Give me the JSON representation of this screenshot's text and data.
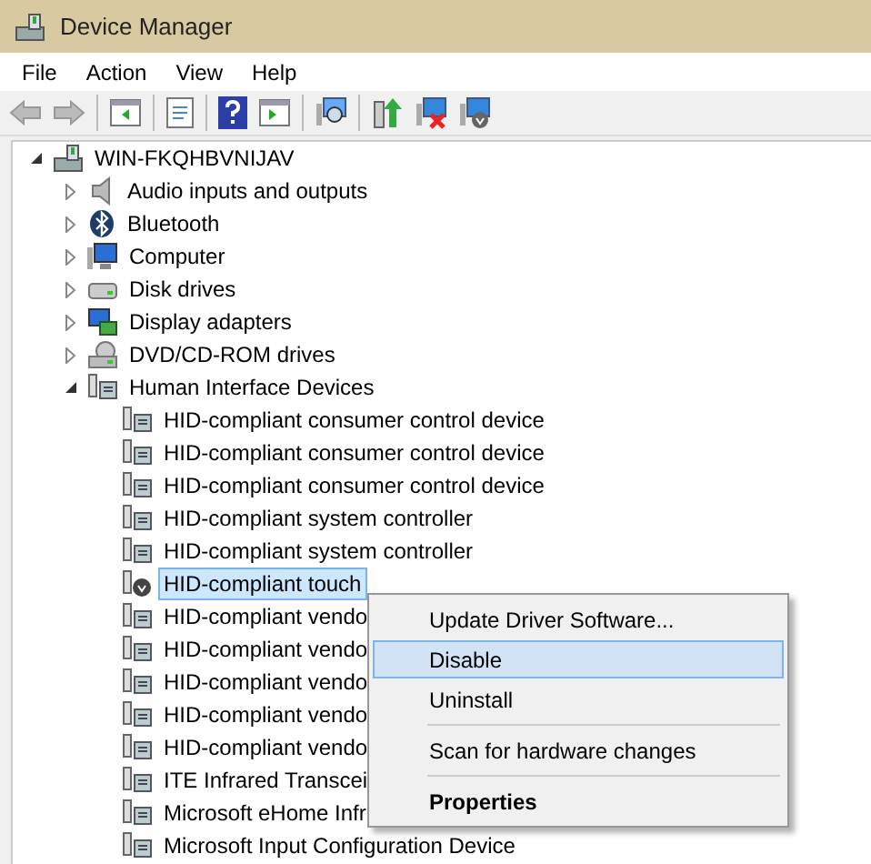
{
  "window": {
    "title": "Device Manager"
  },
  "menu": [
    "File",
    "Action",
    "View",
    "Help"
  ],
  "toolbar": [
    {
      "kind": "back",
      "disabled": true
    },
    {
      "kind": "forward",
      "disabled": true
    },
    {
      "kind": "sep"
    },
    {
      "kind": "panel"
    },
    {
      "kind": "sep"
    },
    {
      "kind": "properties"
    },
    {
      "kind": "sep"
    },
    {
      "kind": "help"
    },
    {
      "kind": "panel2"
    },
    {
      "kind": "sep"
    },
    {
      "kind": "scan"
    },
    {
      "kind": "sep"
    },
    {
      "kind": "update"
    },
    {
      "kind": "disable"
    },
    {
      "kind": "uninstall"
    }
  ],
  "tree": [
    {
      "label": "WIN-FKQHBVNIJAV",
      "kind": "computer",
      "expanded": true,
      "selected": false,
      "children": [
        {
          "label": "Audio inputs and outputs",
          "kind": "speaker",
          "expanded": false,
          "selected": false
        },
        {
          "label": "Bluetooth",
          "kind": "bluetooth",
          "expanded": false,
          "selected": false
        },
        {
          "label": "Computer",
          "kind": "monitor",
          "expanded": false,
          "selected": false
        },
        {
          "label": "Disk drives",
          "kind": "disk",
          "expanded": false,
          "selected": false
        },
        {
          "label": "Display adapters",
          "kind": "display",
          "expanded": false,
          "selected": false
        },
        {
          "label": "DVD/CD-ROM drives",
          "kind": "dvd",
          "expanded": false,
          "selected": false
        },
        {
          "label": "Human Interface Devices",
          "kind": "hid",
          "expanded": true,
          "selected": false,
          "children": [
            {
              "label": "HID-compliant consumer control device",
              "selected": false
            },
            {
              "label": "HID-compliant consumer control device",
              "selected": false
            },
            {
              "label": "HID-compliant consumer control device",
              "selected": false
            },
            {
              "label": "HID-compliant system controller",
              "selected": false
            },
            {
              "label": "HID-compliant system controller",
              "selected": false
            },
            {
              "label": "HID-compliant touch",
              "kind": "hid-down",
              "selected": true
            },
            {
              "label": "HID-compliant vendo",
              "selected": false
            },
            {
              "label": "HID-compliant vendo",
              "selected": false
            },
            {
              "label": "HID-compliant vendo",
              "selected": false
            },
            {
              "label": "HID-compliant vendo",
              "selected": false
            },
            {
              "label": "HID-compliant vendo",
              "selected": false
            },
            {
              "label": "ITE Infrared Transcei",
              "selected": false
            },
            {
              "label": "Microsoft eHome Infr",
              "selected": false
            },
            {
              "label": "Microsoft Input Configuration Device",
              "selected": false
            }
          ]
        }
      ]
    }
  ],
  "context_menu": [
    {
      "kind": "item",
      "label": "Update Driver Software...",
      "selected": false,
      "bold": false
    },
    {
      "kind": "item",
      "label": "Disable",
      "selected": true,
      "bold": false
    },
    {
      "kind": "item",
      "label": "Uninstall",
      "selected": false,
      "bold": false
    },
    {
      "kind": "separator"
    },
    {
      "kind": "item",
      "label": "Scan for hardware changes",
      "selected": false,
      "bold": false
    },
    {
      "kind": "separator"
    },
    {
      "kind": "item",
      "label": "Properties",
      "selected": false,
      "bold": true
    }
  ]
}
